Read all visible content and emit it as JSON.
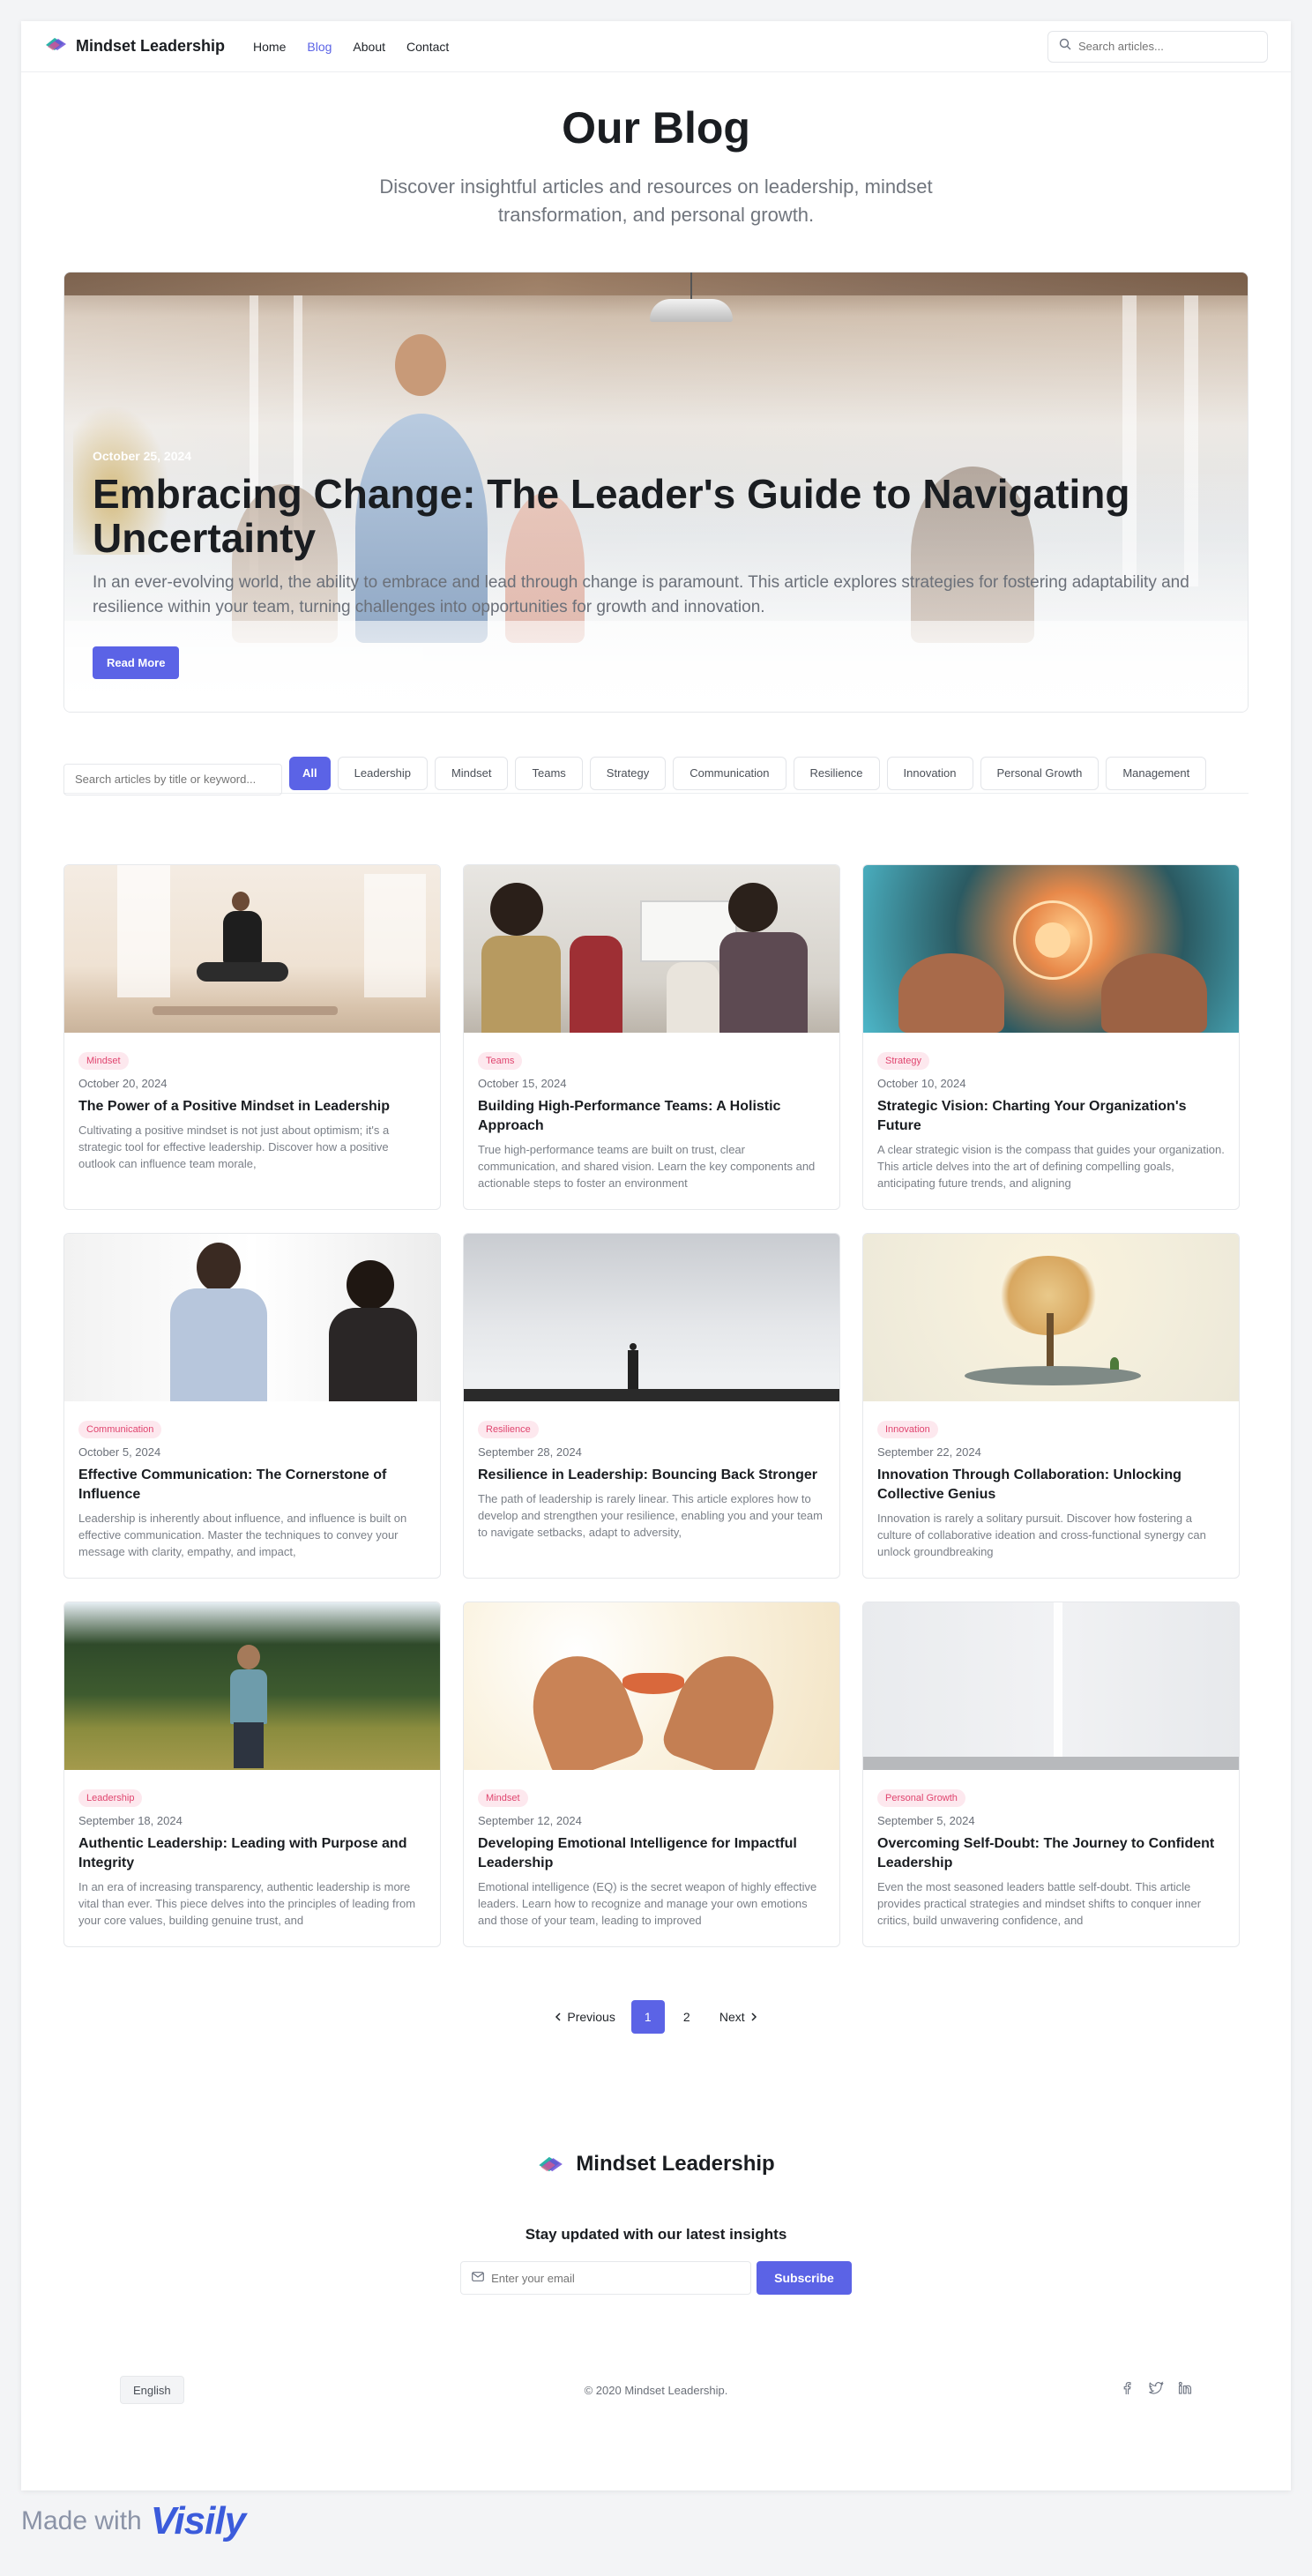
{
  "brand": {
    "name": "Mindset Leadership"
  },
  "nav": {
    "items": [
      "Home",
      "Blog",
      "About",
      "Contact"
    ],
    "active": "Blog"
  },
  "header_search": {
    "placeholder": "Search articles..."
  },
  "hero": {
    "title": "Our Blog",
    "subtitle": "Discover insightful articles and resources on leadership, mindset transformation, and personal growth."
  },
  "featured": {
    "date": "October 25, 2024",
    "title": "Embracing Change: The Leader's Guide to Navigating Uncertainty",
    "excerpt": "In an ever-evolving world, the ability to embrace and lead through change is paramount. This article explores strategies for fostering adaptability and resilience within your team, turning challenges into opportunities for growth and innovation.",
    "button": "Read More"
  },
  "filters": {
    "search_placeholder": "Search articles by title or keyword...",
    "chips": [
      "All",
      "Leadership",
      "Mindset",
      "Teams",
      "Strategy",
      "Communication",
      "Resilience",
      "Innovation",
      "Personal Growth",
      "Management"
    ],
    "active": "All"
  },
  "posts": [
    {
      "tag": "Mindset",
      "date": "October 20, 2024",
      "title": "The Power of a Positive Mindset in Leadership",
      "excerpt": "Cultivating a positive mindset is not just about optimism; it's a strategic tool for effective leadership. Discover how a positive outlook can influence team morale,"
    },
    {
      "tag": "Teams",
      "date": "October 15, 2024",
      "title": "Building High-Performance Teams: A Holistic Approach",
      "excerpt": "True high-performance teams are built on trust, clear communication, and shared vision. Learn the key components and actionable steps to foster an environment"
    },
    {
      "tag": "Strategy",
      "date": "October 10, 2024",
      "title": "Strategic Vision: Charting Your Organization's Future",
      "excerpt": "A clear strategic vision is the compass that guides your organization. This article delves into the art of defining compelling goals, anticipating future trends, and aligning"
    },
    {
      "tag": "Communication",
      "date": "October 5, 2024",
      "title": "Effective Communication: The Cornerstone of Influence",
      "excerpt": "Leadership is inherently about influence, and influence is built on effective communication. Master the techniques to convey your message with clarity, empathy, and impact,"
    },
    {
      "tag": "Resilience",
      "date": "September 28, 2024",
      "title": "Resilience in Leadership: Bouncing Back Stronger",
      "excerpt": "The path of leadership is rarely linear. This article explores how to develop and strengthen your resilience, enabling you and your team to navigate setbacks, adapt to adversity,"
    },
    {
      "tag": "Innovation",
      "date": "September 22, 2024",
      "title": "Innovation Through Collaboration: Unlocking Collective Genius",
      "excerpt": "Innovation is rarely a solitary pursuit. Discover how fostering a culture of collaborative ideation and cross-functional synergy can unlock groundbreaking"
    },
    {
      "tag": "Leadership",
      "date": "September 18, 2024",
      "title": "Authentic Leadership: Leading with Purpose and Integrity",
      "excerpt": "In an era of increasing transparency, authentic leadership is more vital than ever. This piece delves into the principles of leading from your core values, building genuine trust, and"
    },
    {
      "tag": "Mindset",
      "date": "September 12, 2024",
      "title": "Developing Emotional Intelligence for Impactful Leadership",
      "excerpt": "Emotional intelligence (EQ) is the secret weapon of highly effective leaders. Learn how to recognize and manage your own emotions and those of your team, leading to improved"
    },
    {
      "tag": "Personal Growth",
      "date": "September 5, 2024",
      "title": "Overcoming Self-Doubt: The Journey to Confident Leadership",
      "excerpt": "Even the most seasoned leaders battle self-doubt. This article provides practical strategies and mindset shifts to conquer inner critics, build unwavering confidence, and"
    }
  ],
  "pagination": {
    "previous": "Previous",
    "pages": [
      "1",
      "2"
    ],
    "current": "1",
    "next": "Next"
  },
  "footer": {
    "brand": "Mindset Leadership",
    "newsletter_title": "Stay updated with our latest insights",
    "email_placeholder": "Enter your email",
    "subscribe": "Subscribe",
    "language": "English",
    "copyright": "© 2020 Mindset Leadership."
  },
  "made_with": {
    "text": "Made with",
    "logo": "Visily"
  },
  "colors": {
    "accent": "#5b63e6",
    "tag_bg": "#fde8ee",
    "tag_text": "#e0456f"
  }
}
